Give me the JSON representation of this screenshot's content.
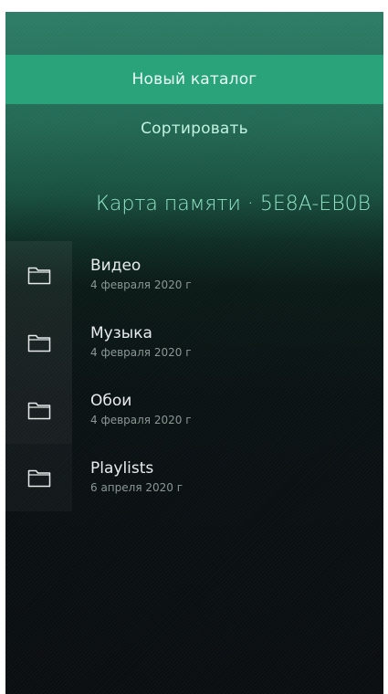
{
  "pulley_menu": {
    "items": [
      {
        "label": "Новый каталог",
        "active": true
      },
      {
        "label": "Сортировать",
        "active": false
      }
    ]
  },
  "header": {
    "title": "Карта памяти · 5E8A-EB0B"
  },
  "folders": [
    {
      "name": "Видео",
      "date": "4 февраля 2020 г",
      "icon": "folder-icon"
    },
    {
      "name": "Музыка",
      "date": "4 февраля 2020 г",
      "icon": "folder-icon"
    },
    {
      "name": "Обои",
      "date": "4 февраля 2020 г",
      "icon": "folder-icon"
    },
    {
      "name": "Playlists",
      "date": "6 апреля 2020 г",
      "icon": "folder-icon"
    }
  ],
  "colors": {
    "accent": "#2aa37b",
    "header_text": "#8fe3c3",
    "menu_text": "#bff3df"
  }
}
